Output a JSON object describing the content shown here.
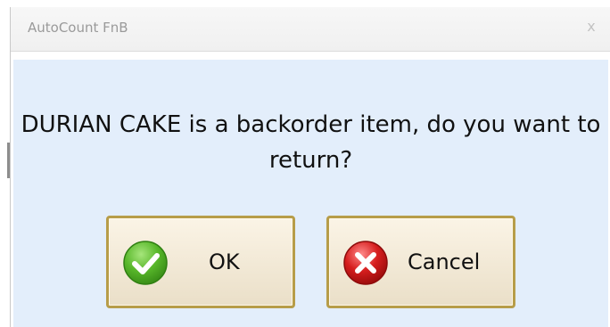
{
  "window": {
    "title": "AutoCount FnB",
    "close_glyph": "x"
  },
  "dialog": {
    "message": "DURIAN CAKE is a backorder item, do you want to return?",
    "buttons": {
      "ok": {
        "label": "OK",
        "icon": "checkmark-circle-icon",
        "color": "#59b82b"
      },
      "cancel": {
        "label": "Cancel",
        "icon": "close-circle-icon",
        "color": "#d61e1e"
      }
    }
  },
  "colors": {
    "dialog_background": "#e3eefb",
    "button_border": "#b79d49"
  }
}
